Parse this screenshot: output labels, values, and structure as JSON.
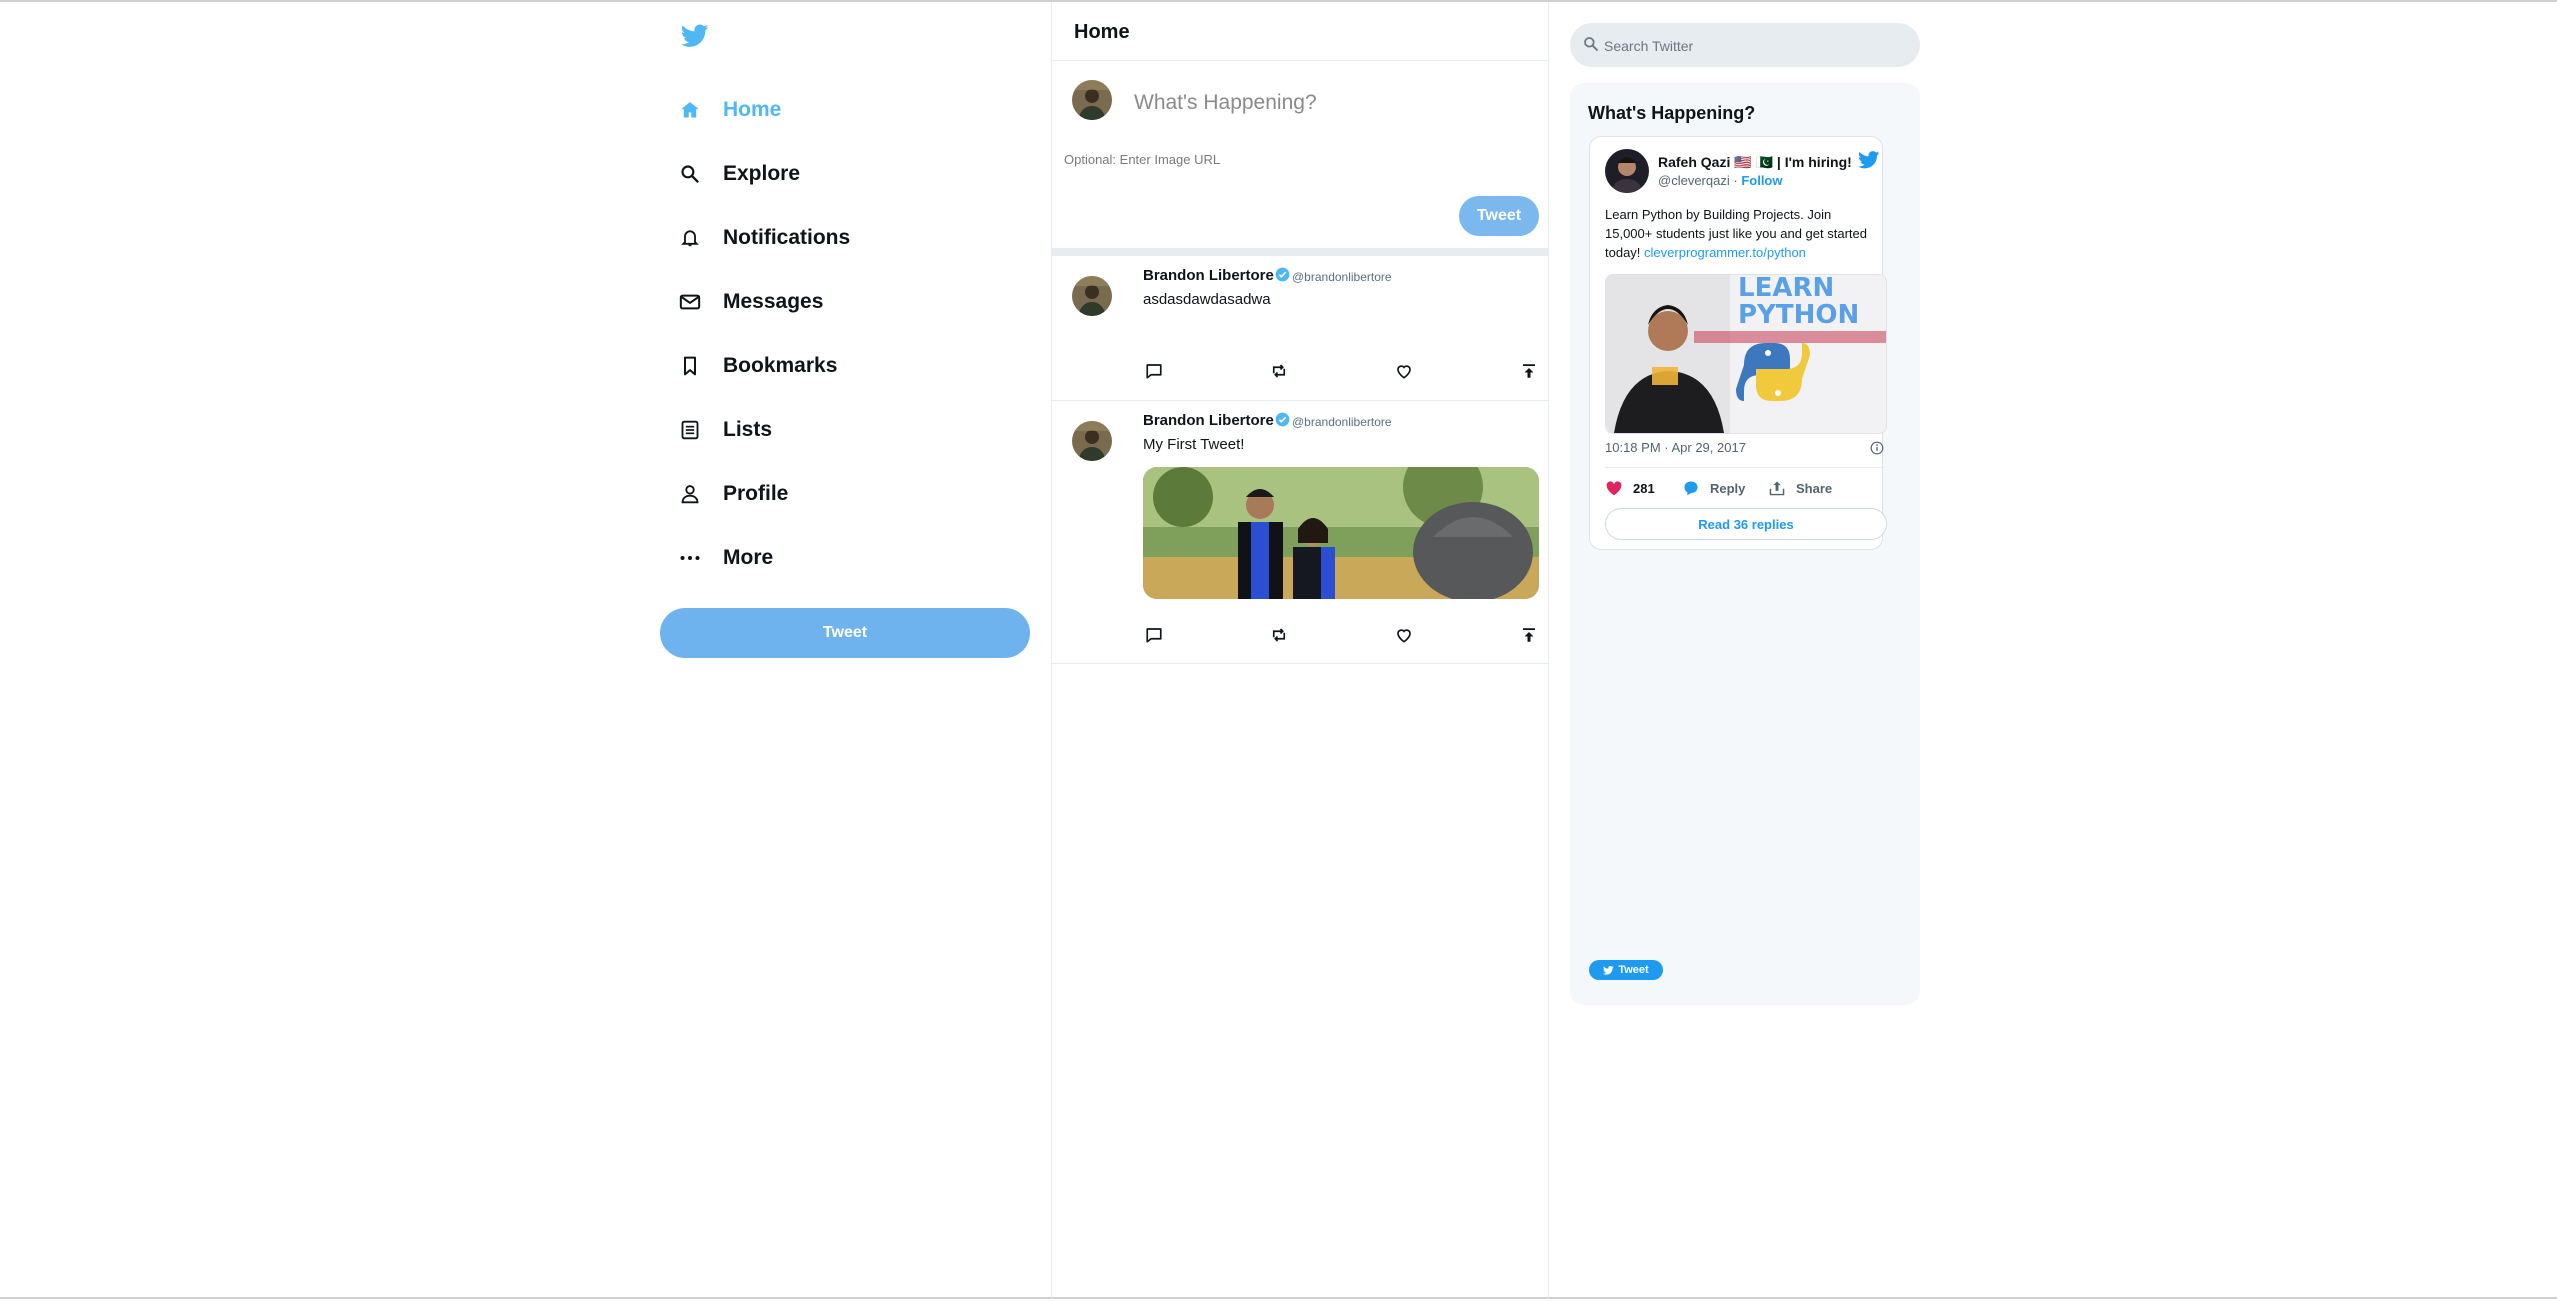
{
  "sidebar": {
    "logo_icon": "twitter-bird-icon",
    "items": [
      {
        "label": "Home",
        "icon": "home-icon",
        "active": true
      },
      {
        "label": "Explore",
        "icon": "search-icon"
      },
      {
        "label": "Notifications",
        "icon": "bell-icon"
      },
      {
        "label": "Messages",
        "icon": "mail-icon"
      },
      {
        "label": "Bookmarks",
        "icon": "bookmark-icon"
      },
      {
        "label": "Lists",
        "icon": "list-icon"
      },
      {
        "label": "Profile",
        "icon": "person-icon"
      },
      {
        "label": "More",
        "icon": "more-icon"
      }
    ],
    "tweet_button": "Tweet"
  },
  "feed": {
    "title": "Home",
    "compose": {
      "placeholder": "What's Happening?",
      "image_placeholder": "Optional: Enter Image URL",
      "tweet_button": "Tweet"
    },
    "posts": [
      {
        "name": "Brandon Libertore",
        "handle": "@brandonlibertore",
        "text": "asdasdawdasadwa",
        "has_image": false
      },
      {
        "name": "Brandon Libertore",
        "handle": "@brandonlibertore",
        "text": "My First Tweet!",
        "has_image": true
      }
    ]
  },
  "widgets": {
    "search_placeholder": "Search Twitter",
    "title": "What's Happening?",
    "embed": {
      "name": "Rafeh Qazi 🇺🇸 🇵🇰 | I'm hiring!",
      "handle": "@cleverqazi",
      "separator": "·",
      "follow": "Follow",
      "text": "Learn Python by Building Projects. Join 15,000+ students just like you and get started today!",
      "link": "cleverprogrammer.to/python",
      "image_text_line1": "LEARN",
      "image_text_line2": "PYTHON",
      "timestamp": "10:18 PM · Apr 29, 2017",
      "likes": "281",
      "reply_label": "Reply",
      "share_label": "Share",
      "read_replies": "Read 36 replies"
    },
    "share_button": "Tweet"
  },
  "colors": {
    "accent": "#50b7f5",
    "tweet_button": "#6fb3ee",
    "link": "#1d9bf0",
    "like": "#e0245e",
    "border": "#e6ecf0",
    "widget_bg": "#f5f8fa"
  }
}
